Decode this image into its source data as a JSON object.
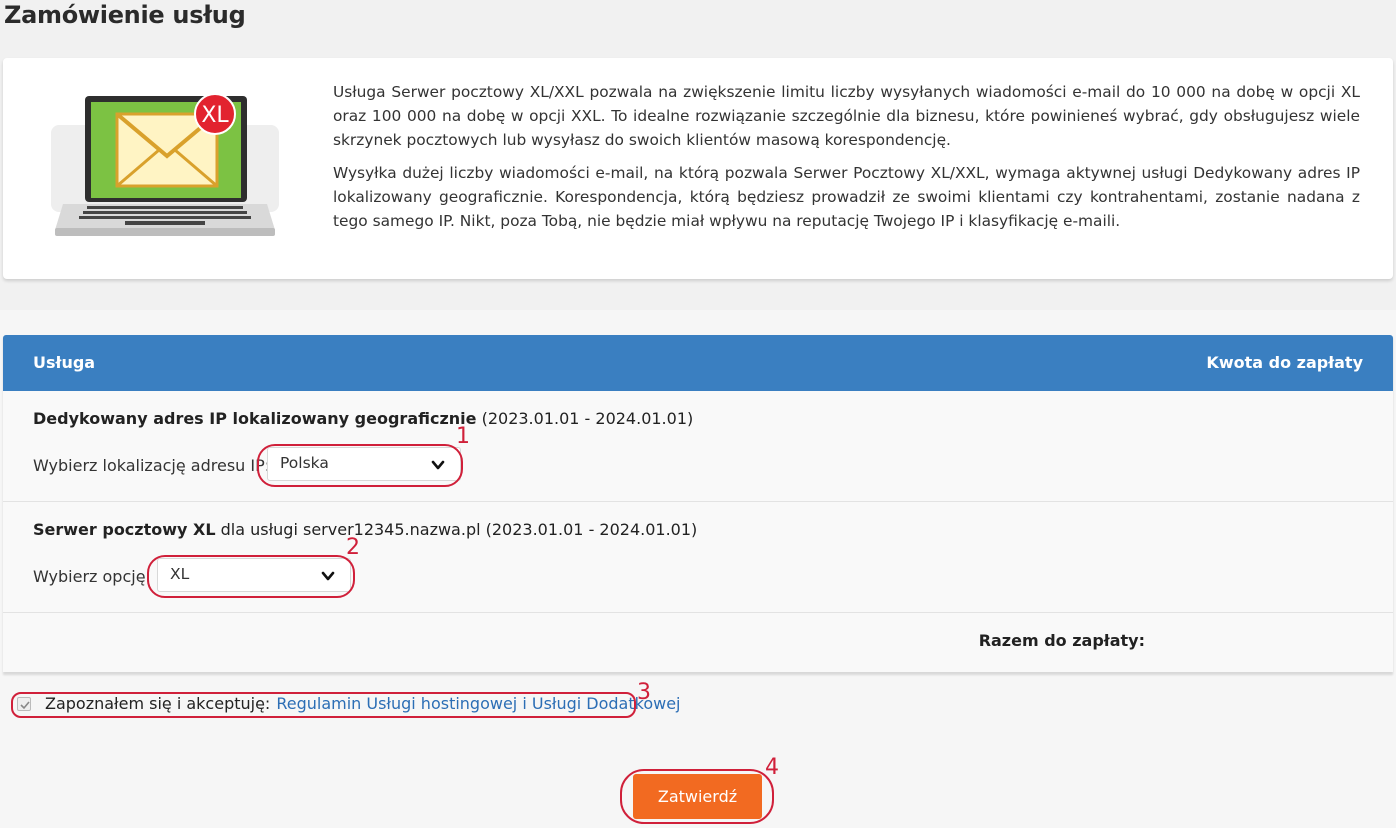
{
  "page": {
    "title": "Zamówienie usług"
  },
  "info": {
    "badge": "XL",
    "paragraph_1": "Usługa Serwer pocztowy XL/XXL pozwala na zwiększenie limitu liczby wysyłanych wiadomości e-mail do 10 000 na dobę w opcji XL oraz 100 000 na dobę w opcji XXL. To idealne rozwiązanie szczególnie dla biznesu, które powinieneś wybrać, gdy obsługujesz wiele skrzynek pocztowych lub wysyłasz do swoich klientów masową korespondencję.",
    "paragraph_2": "Wysyłka dużej liczby wiadomości e-mail, na którą pozwala Serwer Pocztowy XL/XXL, wymaga aktywnej usługi Dedykowany adres IP lokalizowany geograficznie. Korespondencja, którą będziesz prowadził ze swoimi klientami czy kontrahentami, zostanie nadana z tego samego IP. Nikt, poza Tobą, nie będzie miał wpływu na reputację Twojego IP i klasyfikację e-maili."
  },
  "table": {
    "col_service": "Usługa",
    "col_amount": "Kwota do zapłaty",
    "rows": [
      {
        "name": "Dedykowany adres IP lokalizowany geograficznie",
        "suffix": " (2023.01.01 - 2024.01.01)",
        "select_label": "Wybierz lokalizację adresu IP:",
        "select_value": "Polska",
        "annotation": "1"
      },
      {
        "name": "Serwer pocztowy XL",
        "suffix": " dla usługi server12345.nazwa.pl (2023.01.01 - 2024.01.01)",
        "select_label": "Wybierz opcję:",
        "select_value": "XL",
        "annotation": "2"
      }
    ],
    "total_label": "Razem do zapłaty:"
  },
  "terms": {
    "text": "Zapoznałem się i akceptuję:",
    "link": "Regulamin Usługi hostingowej i Usługi Dodatkowej",
    "annotation": "3",
    "checked": true
  },
  "submit": {
    "label": "Zatwierdź",
    "annotation": "4"
  },
  "colors": {
    "header": "#3a7fc1",
    "button": "#f26a21",
    "annotation": "#d0203a",
    "link": "#2c6eb5"
  }
}
